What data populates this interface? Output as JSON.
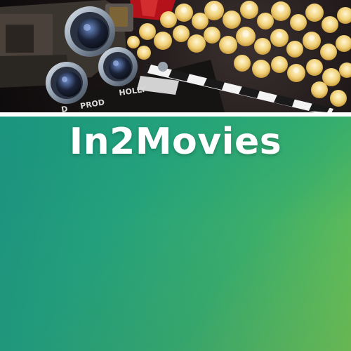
{
  "brand": {
    "title": "In2Movies"
  },
  "hero": {
    "clapperboard_text_1": "HOLLY",
    "clapperboard_text_2": "PROD",
    "clapperboard_text_3": "D"
  },
  "colors": {
    "gradient_start": "#1a8c80",
    "gradient_end": "#7cc64a",
    "divider": "#ffffff",
    "title": "#ffffff"
  },
  "icons": {
    "camera": "vintage-film-camera-icon",
    "clapperboard": "clapperboard-icon",
    "popcorn": "popcorn-icon"
  }
}
